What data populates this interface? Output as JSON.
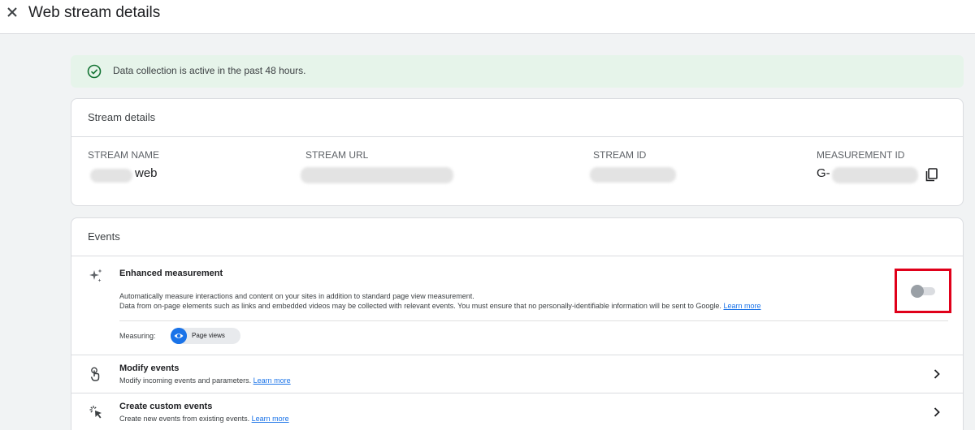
{
  "header": {
    "title": "Web stream details"
  },
  "banner": {
    "text": "Data collection is active in the past 48 hours."
  },
  "stream_details": {
    "title": "Stream details",
    "fields": [
      {
        "label": "STREAM NAME",
        "visible_value": "web"
      },
      {
        "label": "STREAM URL",
        "visible_value": ""
      },
      {
        "label": "STREAM ID",
        "visible_value": ""
      },
      {
        "label": "MEASUREMENT ID",
        "visible_value": "G-"
      }
    ]
  },
  "events": {
    "title": "Events",
    "enhanced": {
      "title": "Enhanced measurement",
      "desc1": "Automatically measure interactions and content on your sites in addition to standard page view measurement.",
      "desc2": "Data from on-page elements such as links and embedded videos may be collected with relevant events. You must ensure that no personally-identifiable information will be sent to Google.",
      "learn_more": "Learn more",
      "measuring_label": "Measuring:",
      "chip_label": "Page views",
      "toggle_on": false
    },
    "rows": [
      {
        "title": "Modify events",
        "desc": "Modify incoming events and parameters.",
        "learn_more": "Learn more"
      },
      {
        "title": "Create custom events",
        "desc": "Create new events from existing events.",
        "learn_more": "Learn more"
      }
    ]
  },
  "colors": {
    "accent": "#1a73e8",
    "success": "#137333",
    "highlight": "#e0001a"
  }
}
